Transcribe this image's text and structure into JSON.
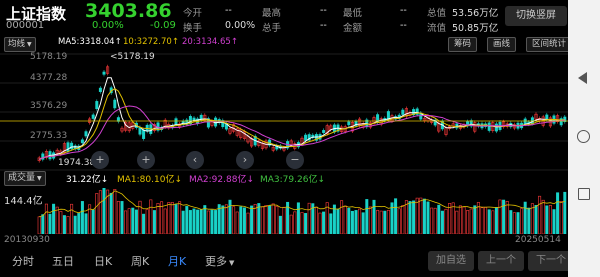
{
  "header": {
    "index_name": "上证指数",
    "price": "3403.86",
    "code": "000001",
    "change_pct": "0.00%",
    "change": "-0.09",
    "row1": [
      {
        "label": "今开",
        "value": "--"
      },
      {
        "label": "最高",
        "value": "--"
      },
      {
        "label": "最低",
        "value": "--"
      },
      {
        "label": "总值",
        "value": "53.56万亿"
      }
    ],
    "row2": [
      {
        "label": "换手",
        "value": "0.00%"
      },
      {
        "label": "总手",
        "value": "--"
      },
      {
        "label": "金额",
        "value": "--"
      },
      {
        "label": "流值",
        "value": "50.85万亿"
      }
    ],
    "switch_button": "切换竖屏"
  },
  "ma_bar": {
    "mode": "均线",
    "ma5": "MA5:3318.04↑",
    "ma10": "10:3272.70↑",
    "ma20": "20:3134.65↑",
    "chips": "筹码",
    "draw": "画线",
    "range_stats": "区间统计"
  },
  "price_chart": {
    "max_label": "5178.19",
    "max_marker": "<5178.19",
    "axis_labels": [
      "4377.28",
      "3576.29",
      "2775.33"
    ],
    "min_label": "1974.38",
    "colors": {
      "up": "#ff3b3b",
      "down": "#19d2c8",
      "ma5": "#ffffff",
      "ma10": "#e0c000",
      "ma20": "#d040d0",
      "ref": "#e0c000"
    }
  },
  "volume": {
    "title": "成交量",
    "value": "31.22亿↓",
    "ma1": "MA1:80.10亿↓",
    "ma2": "MA2:92.88亿↓",
    "ma3": "MA3:79.26亿↓",
    "max_label": "144.4亿",
    "start_date": "20130930",
    "end_date": "20250514"
  },
  "tabs": [
    "分时",
    "五日",
    "日K",
    "周K",
    "月K",
    "更多"
  ],
  "active_tab": "月K",
  "buttons": {
    "add_watch": "加自选",
    "prev": "上一个",
    "next": "下一个"
  },
  "icons": {
    "add": "plus-icon",
    "prev": "chevron-left-icon",
    "next": "chevron-right-icon",
    "more": "caret-down-icon"
  }
}
